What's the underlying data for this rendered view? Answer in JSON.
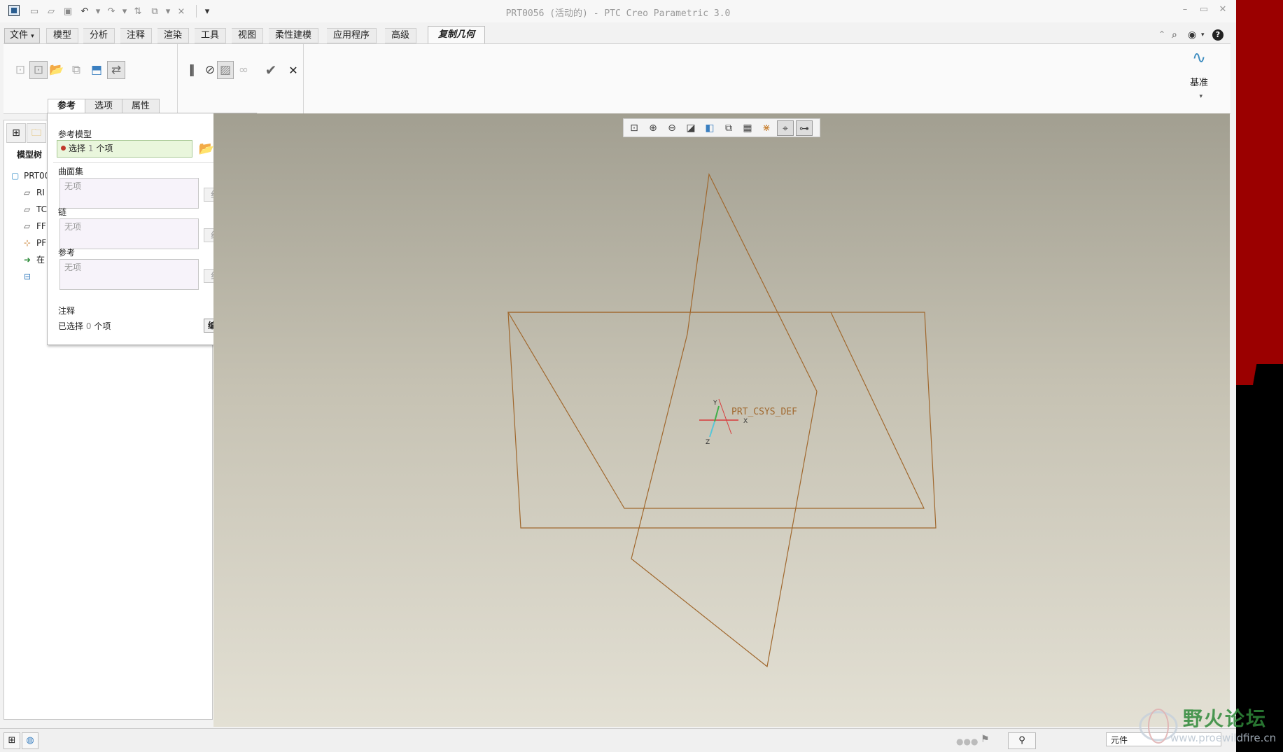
{
  "window": {
    "title": "PRT0056 (活动的) - PTC Creo Parametric 3.0",
    "controls": [
      "–",
      "▭",
      "✕"
    ]
  },
  "quick_access": {
    "icons": [
      "new-file-icon",
      "open-file-icon",
      "save-icon",
      "undo-icon",
      "redo-icon",
      "regenerate-icon",
      "windows-icon",
      "close-window-icon",
      "customize-icon"
    ]
  },
  "ribbon": {
    "file_label": "文件",
    "tabs": [
      "模型",
      "分析",
      "注释",
      "渲染",
      "工具",
      "视图",
      "柔性建模",
      "应用程序",
      "高级"
    ],
    "active_tab": "复制几何",
    "datum_label": "基准"
  },
  "dashboard": {
    "tabs": [
      "参考",
      "选项",
      "属性"
    ],
    "active_tab": "参考"
  },
  "ref_panel": {
    "ref_model_label": "参考模型",
    "select_prefix": "选择",
    "select_count": "1",
    "select_suffix": "个项",
    "surface_set_label": "曲面集",
    "surface_set_value": "无项",
    "chain_label": "链",
    "chain_value": "无项",
    "reference_label": "参考",
    "reference_value": "无项",
    "detail_button": "细节...",
    "note_label": "注释",
    "selected_prefix": "已选择",
    "selected_count": "0",
    "selected_suffix": "个项",
    "edit_button": "编辑"
  },
  "model_tree": {
    "header": "模型树",
    "items": [
      "PRT00",
      "RI",
      "TC",
      "FF",
      "PF",
      "在"
    ]
  },
  "viewport": {
    "csys_label": "PRT_CSYS_DEF",
    "axis_x": "X",
    "axis_y": "Y",
    "axis_z": "Z"
  },
  "statusbar": {
    "filter_value": "元件"
  },
  "watermark": {
    "text": "野火论坛",
    "url": "www.proewildfire.cn"
  },
  "colors": {
    "datum_plane": "#a0682e",
    "active_tab_bg": "#fafafa",
    "selection_box": "#e9f6dc",
    "csys_green": "#3fae49",
    "csys_red": "#d83a3a",
    "csys_cyan": "#58c6d8"
  }
}
